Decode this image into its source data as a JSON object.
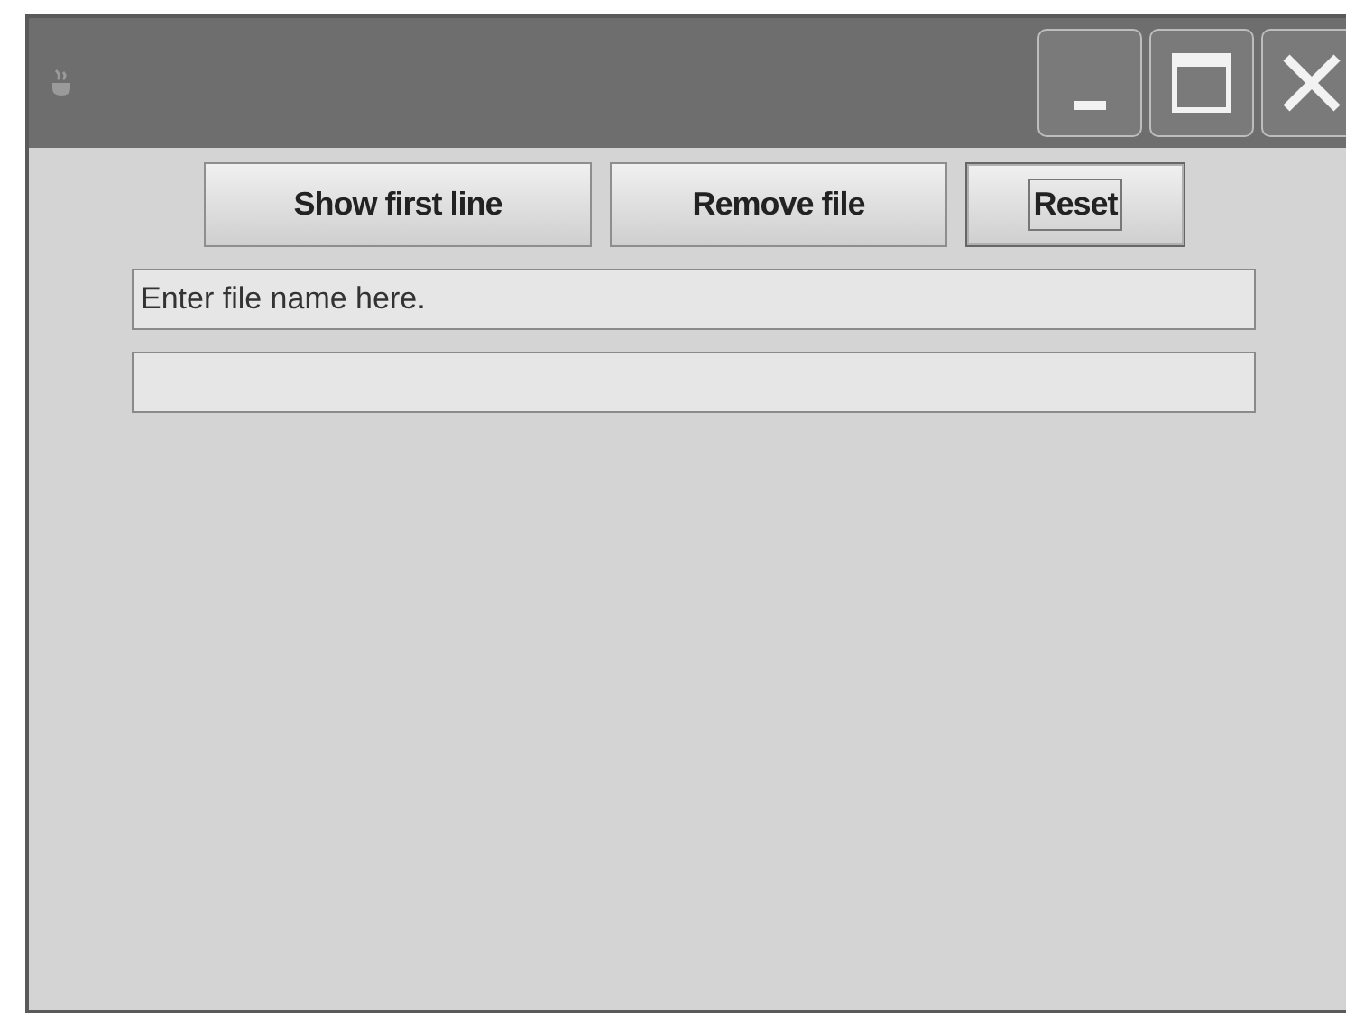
{
  "buttons": [
    {
      "label": "Show first line",
      "focused": false
    },
    {
      "label": "Remove file",
      "focused": false
    },
    {
      "label": "Reset",
      "focused": true
    }
  ],
  "fields": [
    {
      "kind": "text",
      "value": "Enter file name here."
    },
    {
      "kind": "text"
    }
  ]
}
